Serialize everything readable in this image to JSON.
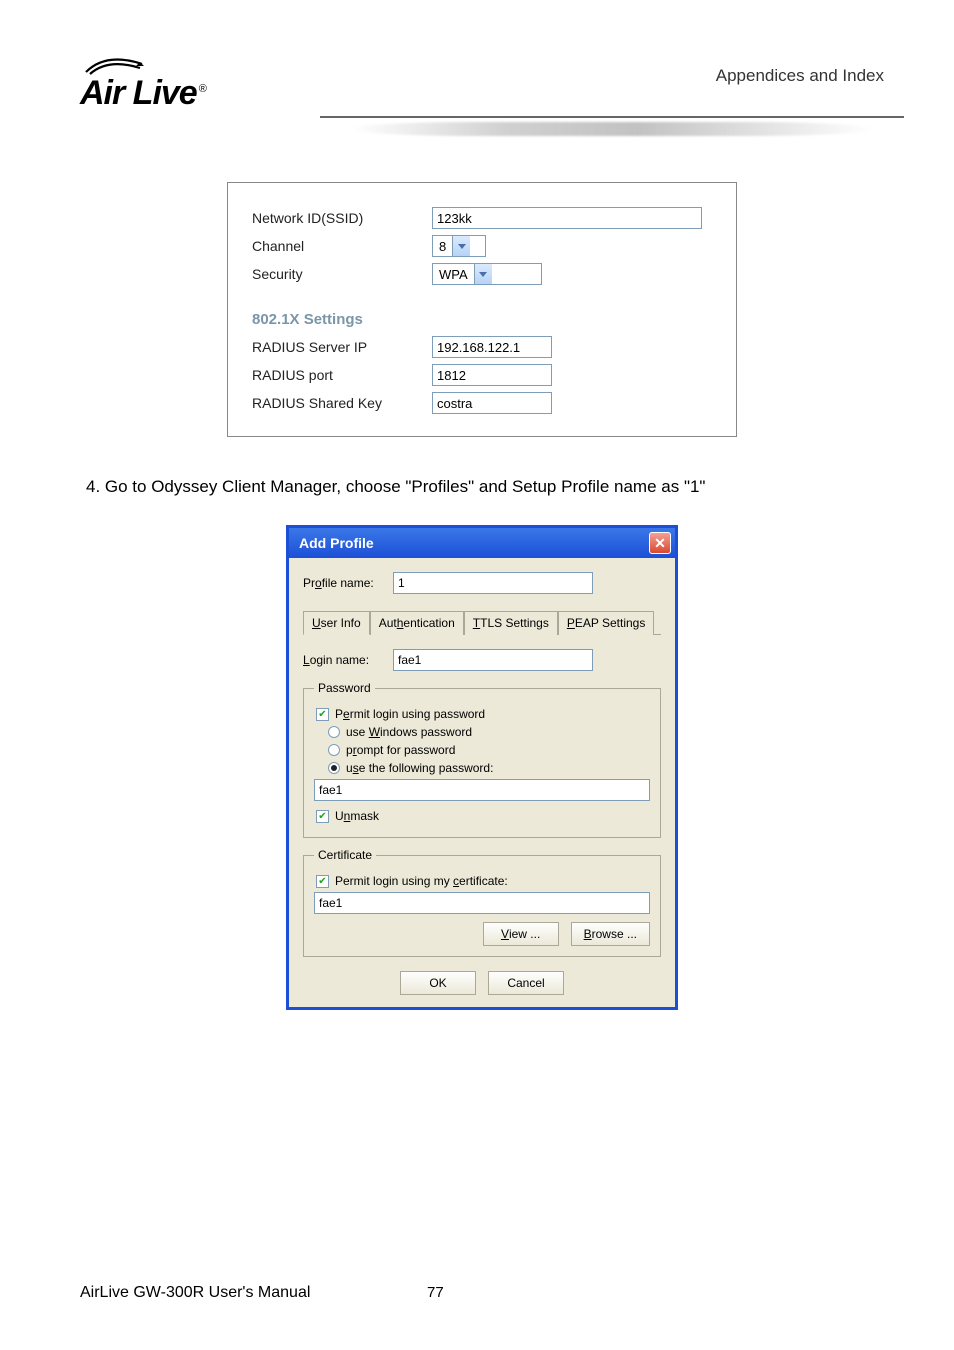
{
  "header": {
    "logo_text": "Air Live",
    "section_label": "Appendices and Index"
  },
  "panel": {
    "rows": {
      "ssid": {
        "label": "Network ID(SSID)",
        "value": "123kk"
      },
      "channel": {
        "label": "Channel",
        "value": "8"
      },
      "security": {
        "label": "Security",
        "value": "WPA"
      }
    },
    "section_title": "802.1X Settings",
    "radius": {
      "ip": {
        "label": "RADIUS Server IP",
        "value": "192.168.122.1"
      },
      "port": {
        "label": "RADIUS port",
        "value": "1812"
      },
      "key": {
        "label": "RADIUS Shared Key",
        "value": "costra"
      }
    }
  },
  "step_text": "4. Go to Odyssey Client Manager, choose \"Profiles\" and Setup Profile name as \"1\"",
  "dialog": {
    "title": "Add Profile",
    "profile": {
      "label": "Profile name:",
      "value": "1"
    },
    "tabs": {
      "t1": "User Info",
      "t2": "Authentication",
      "t3": "TTLS Settings",
      "t4": "PEAP Settings"
    },
    "login": {
      "label": "Login name:",
      "value": "fae1"
    },
    "password_group": {
      "legend": "Password",
      "permit_label": "Permit login using password",
      "opt_windows": "use Windows password",
      "opt_prompt": "prompt for password",
      "opt_following": "use the following password:",
      "value": "fae1",
      "unmask_label": "Unmask"
    },
    "cert_group": {
      "legend": "Certificate",
      "permit_label": "Permit login using my certificate:",
      "value": "fae1",
      "view_btn": "View ...",
      "browse_btn": "Browse ..."
    },
    "ok_btn": "OK",
    "cancel_btn": "Cancel"
  },
  "footer": {
    "manual": "AirLive GW-300R User's Manual",
    "page": "77"
  }
}
